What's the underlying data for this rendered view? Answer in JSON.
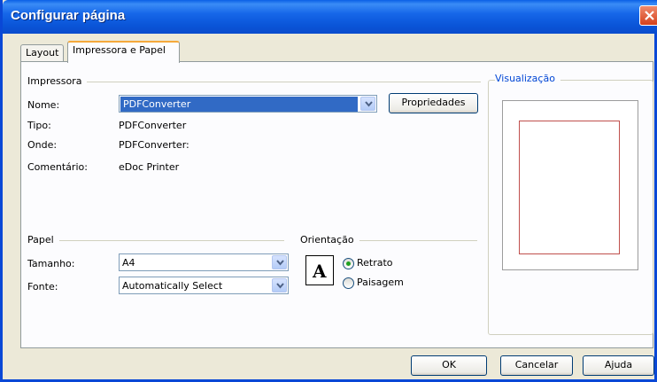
{
  "window": {
    "title": "Configurar página"
  },
  "tabs": [
    {
      "label": "Layout"
    },
    {
      "label": "Impressora e Papel"
    }
  ],
  "printer": {
    "group_label": "Impressora",
    "name_label": "Nome:",
    "name_value": "PDFConverter",
    "properties_button": "Propriedades",
    "type_label": "Tipo:",
    "type_value": "PDFConverter",
    "where_label": "Onde:",
    "where_value": "PDFConverter:",
    "comment_label": "Comentário:",
    "comment_value": "eDoc Printer"
  },
  "paper": {
    "group_label": "Papel",
    "size_label": "Tamanho:",
    "size_value": "A4",
    "source_label": "Fonte:",
    "source_value": "Automatically Select"
  },
  "orientation": {
    "group_label": "Orientação",
    "icon_letter": "A",
    "options": [
      {
        "label": "Retrato",
        "selected": true
      },
      {
        "label": "Paisagem",
        "selected": false
      }
    ]
  },
  "preview": {
    "label": "Visualização"
  },
  "buttons": {
    "ok": "OK",
    "cancel": "Cancelar",
    "help": "Ajuda"
  },
  "colors": {
    "title_bar": "#0a55d8",
    "selection": "#316ac5",
    "margin_line": "#c0504d"
  }
}
